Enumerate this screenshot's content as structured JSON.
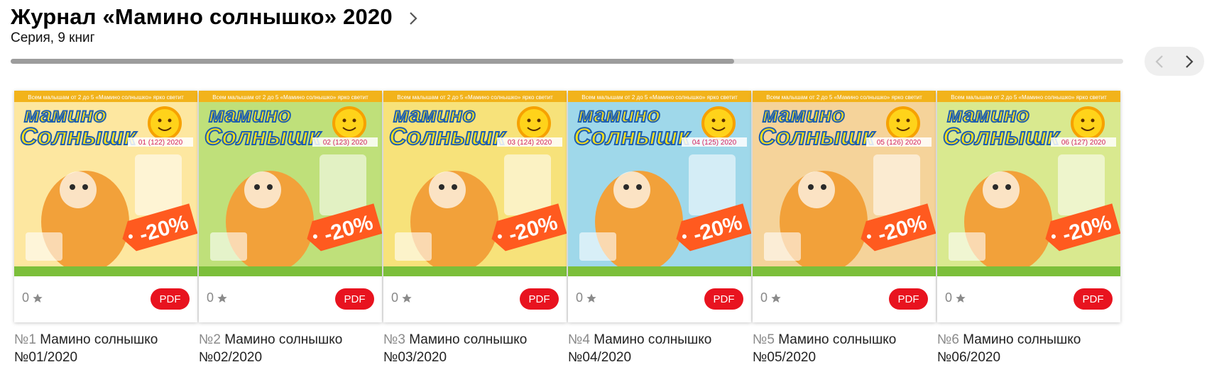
{
  "series": {
    "title": "Журнал «Мамино солнышко» 2020",
    "subtitle": "Серия, 9 книг",
    "scroll_progress": 0.65
  },
  "colors": {
    "pdf_badge": "#e8131f",
    "discount_badge": "#ff5a1f",
    "progress_fill": "#9c9c9c",
    "progress_track": "#e4e4e4"
  },
  "books": [
    {
      "num": "№1",
      "name": "Мамино солнышко №01/2020",
      "rating": "0",
      "badge": "PDF",
      "discount": "-20%",
      "cover_issue": "01 (122) 2020",
      "cover_bg": "#fde7a0"
    },
    {
      "num": "№2",
      "name": "Мамино солнышко №02/2020",
      "rating": "0",
      "badge": "PDF",
      "discount": "-20%",
      "cover_issue": "02 (123) 2020",
      "cover_bg": "#bfe07a"
    },
    {
      "num": "№3",
      "name": "Мамино солнышко №03/2020",
      "rating": "0",
      "badge": "PDF",
      "discount": "-20%",
      "cover_issue": "03 (124) 2020",
      "cover_bg": "#f7e27a"
    },
    {
      "num": "№4",
      "name": "Мамино солнышко №04/2020",
      "rating": "0",
      "badge": "PDF",
      "discount": "-20%",
      "cover_issue": "04 (125) 2020",
      "cover_bg": "#9fd8ea"
    },
    {
      "num": "№5",
      "name": "Мамино солнышко №05/2020",
      "rating": "0",
      "badge": "PDF",
      "discount": "-20%",
      "cover_issue": "05 (126) 2020",
      "cover_bg": "#f5d39a"
    },
    {
      "num": "№6",
      "name": "Мамино солнышко №06/2020",
      "rating": "0",
      "badge": "PDF",
      "discount": "-20%",
      "cover_issue": "06 (127) 2020",
      "cover_bg": "#d9e98f"
    }
  ],
  "icons": {
    "title_chevron": "chevron-right-icon",
    "prev": "chevron-left-icon",
    "next": "chevron-right-icon",
    "star": "star-icon"
  }
}
